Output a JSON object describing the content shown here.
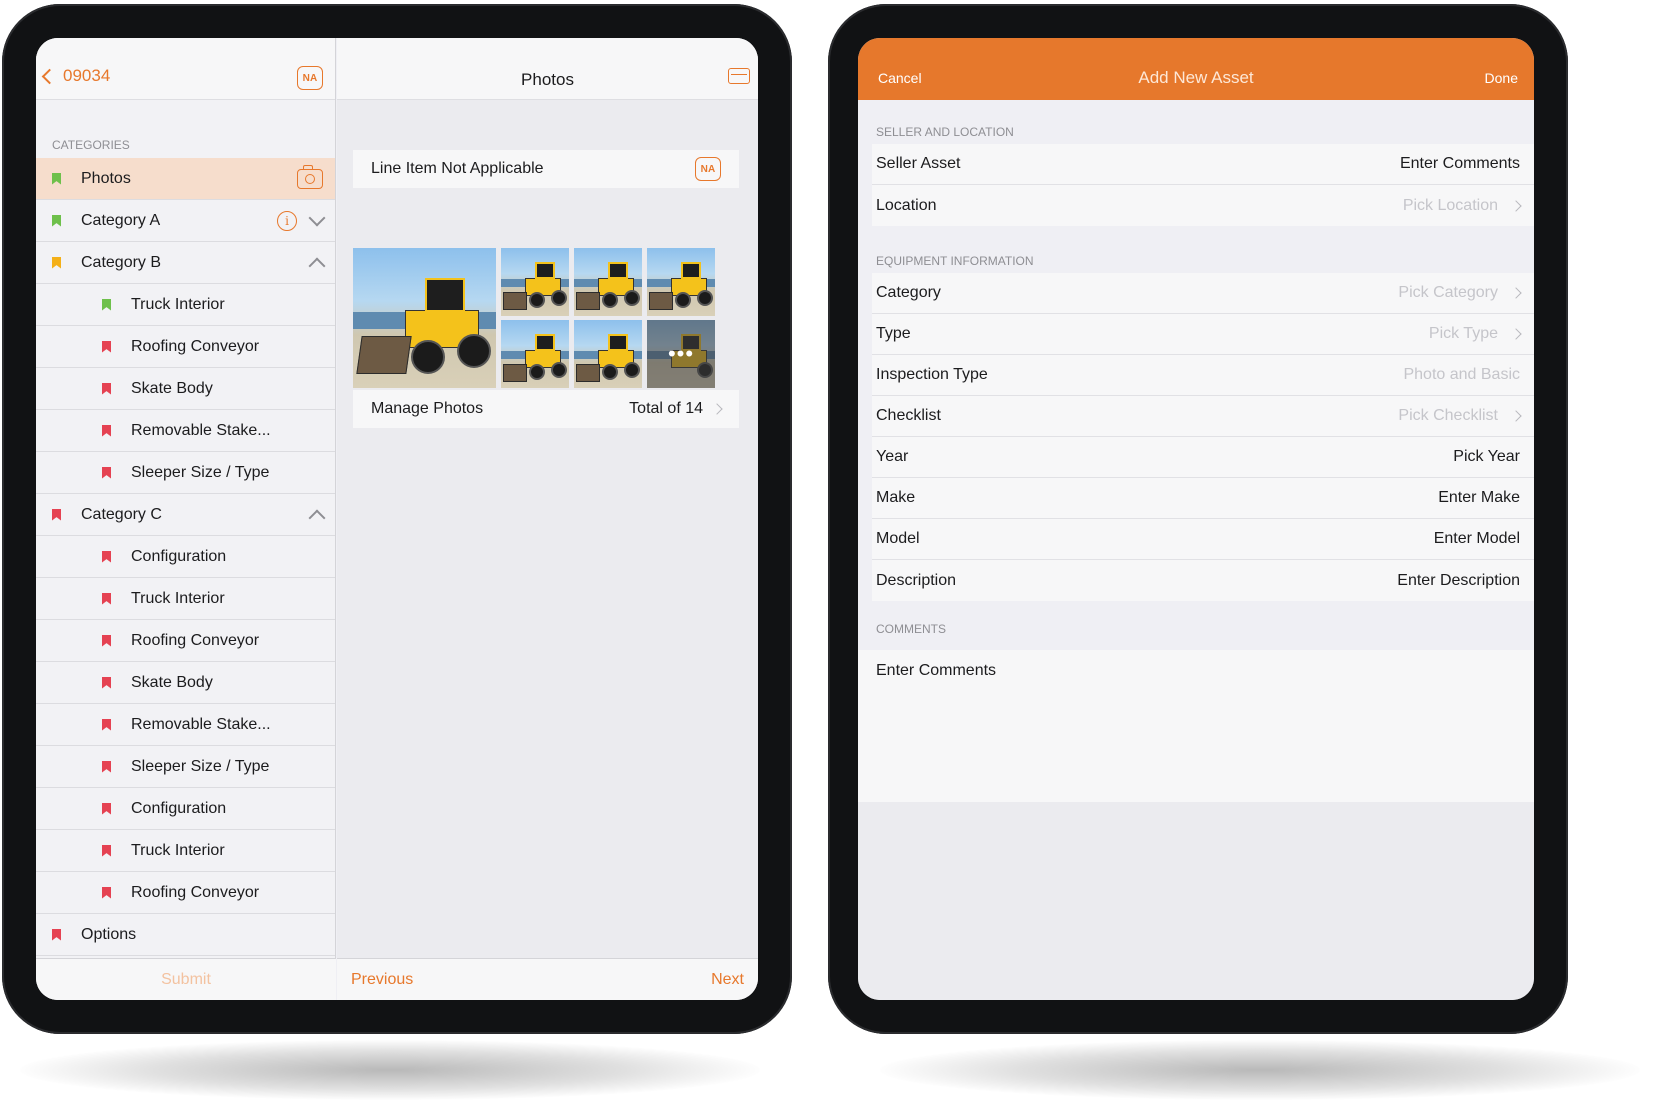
{
  "left_device": {
    "back_label": "09034",
    "na_label": "NA",
    "categories_header": "CATEGORIES",
    "items": [
      {
        "label": "Photos",
        "flag": "green",
        "level": "top",
        "selected": true,
        "right": "camera"
      },
      {
        "label": "Category A",
        "flag": "green",
        "level": "top",
        "right": "info-expand"
      },
      {
        "label": "Category B",
        "flag": "yellow",
        "level": "top",
        "right": "collapse"
      },
      {
        "label": "Truck Interior",
        "flag": "green",
        "level": "sub"
      },
      {
        "label": "Roofing Conveyor",
        "flag": "red",
        "level": "sub"
      },
      {
        "label": "Skate Body",
        "flag": "red",
        "level": "sub"
      },
      {
        "label": "Removable Stake...",
        "flag": "red",
        "level": "sub"
      },
      {
        "label": "Sleeper Size / Type",
        "flag": "red",
        "level": "sub"
      },
      {
        "label": "Category C",
        "flag": "red",
        "level": "top",
        "right": "collapse"
      },
      {
        "label": "Configuration",
        "flag": "red",
        "level": "sub"
      },
      {
        "label": "Truck Interior",
        "flag": "red",
        "level": "sub"
      },
      {
        "label": "Roofing Conveyor",
        "flag": "red",
        "level": "sub"
      },
      {
        "label": "Skate Body",
        "flag": "red",
        "level": "sub"
      },
      {
        "label": "Removable Stake...",
        "flag": "red",
        "level": "sub"
      },
      {
        "label": "Sleeper Size / Type",
        "flag": "red",
        "level": "sub"
      },
      {
        "label": "Configuration",
        "flag": "red",
        "level": "sub"
      },
      {
        "label": "Truck Interior",
        "flag": "red",
        "level": "sub"
      },
      {
        "label": "Roofing Conveyor",
        "flag": "red",
        "level": "sub"
      },
      {
        "label": "Options",
        "flag": "red",
        "level": "top"
      }
    ],
    "submit_label": "Submit",
    "detail": {
      "title": "Photos",
      "not_applicable_label": "Line Item Not Applicable",
      "na_label": "NA",
      "more_label": "•••",
      "manage_label": "Manage Photos",
      "total_label": "Total of 14"
    },
    "previous_label": "Previous",
    "next_label": "Next"
  },
  "right_device": {
    "cancel_label": "Cancel",
    "title": "Add New Asset",
    "done_label": "Done",
    "section1": {
      "header": "SELLER AND LOCATION",
      "rows": [
        {
          "label": "Seller Asset",
          "value": "Enter Comments",
          "placeholder": false,
          "chevron": false
        },
        {
          "label": "Location",
          "value": "Pick Location",
          "placeholder": true,
          "chevron": true
        }
      ]
    },
    "section2": {
      "header": "EQUIPMENT INFORMATION",
      "rows": [
        {
          "label": "Category",
          "value": "Pick Category",
          "placeholder": true,
          "chevron": true
        },
        {
          "label": "Type",
          "value": "Pick Type",
          "placeholder": true,
          "chevron": true
        },
        {
          "label": "Inspection Type",
          "value": "Photo and Basic",
          "placeholder": true,
          "chevron": false
        },
        {
          "label": "Checklist",
          "value": "Pick Checklist",
          "placeholder": true,
          "chevron": true
        },
        {
          "label": "Year",
          "value": "Pick Year",
          "placeholder": false,
          "chevron": false
        },
        {
          "label": "Make",
          "value": "Enter Make",
          "placeholder": false,
          "chevron": false
        },
        {
          "label": "Model",
          "value": "Enter Model",
          "placeholder": false,
          "chevron": false
        },
        {
          "label": "Description",
          "value": "Enter Description",
          "placeholder": false,
          "chevron": false
        }
      ]
    },
    "section3": {
      "header": "COMMENTS",
      "placeholder": "Enter Comments"
    }
  },
  "colors": {
    "accent": "#e7782c",
    "flag_green": "#6ec04b",
    "flag_yellow": "#f4b018",
    "flag_red": "#e54252"
  }
}
